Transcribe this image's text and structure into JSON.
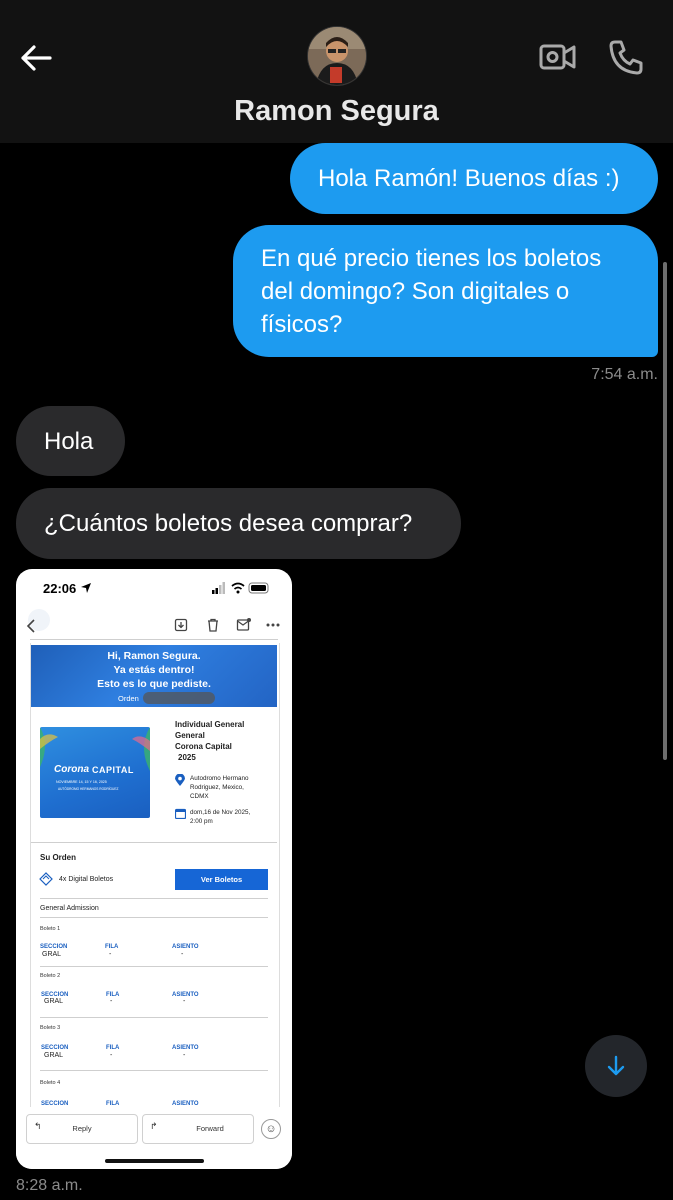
{
  "header": {
    "contact_name": "Ramon Segura",
    "back_icon": "arrow-left-icon",
    "video_icon": "video-call-icon",
    "phone_icon": "phone-icon"
  },
  "messages": {
    "out1": "Hola Ramón! Buenos días :)",
    "out2": "En qué precio tienes los boletos del domingo? Son digitales o físicos?",
    "out_time": "7:54 a.m.",
    "in1": "Hola",
    "in2": "¿Cuántos boletos desea comprar?",
    "image_time": "8:28 a.m."
  },
  "screenshot": {
    "status_time": "22:06",
    "hero_line1": "Hi, Ramon Segura.",
    "hero_line2": "Ya estás dentro!",
    "hero_line3": "Esto es lo que pediste.",
    "order_label": "Orden",
    "poster_brand": "Corona",
    "poster_title": "CAPITAL",
    "poster_dates": "NOVIEMBRE 14, 15 Y 16, 2025",
    "poster_venue": "AUTÓDROMO HERMANOS RODRÍGUEZ",
    "ticket_type_1": "Individual General",
    "ticket_type_2": "General",
    "event_name": "Corona Capital",
    "event_year": "2025",
    "venue_1": "Autodromo Hermano",
    "venue_2": "Rodriguez, Mexico,",
    "venue_3": "CDMX",
    "date_1": "dom,16 de Nov 2025,",
    "date_2": "2:00 pm",
    "order_title": "Su Orden",
    "qty_text": "4x Digital Boletos",
    "ver_boletos": "Ver Boletos",
    "admission": "General Admission",
    "col_section": "SECCION",
    "col_row": "FILA",
    "col_seat": "ASIENTO",
    "tickets": [
      {
        "label": "Boleto 1",
        "section": "GRAL",
        "row": "-",
        "seat": "-"
      },
      {
        "label": "Boleto 2",
        "section": "GRAL",
        "row": "-",
        "seat": "-"
      },
      {
        "label": "Boleto 3",
        "section": "GRAL",
        "row": "-",
        "seat": "-"
      },
      {
        "label": "Boleto 4",
        "section": "",
        "row": "",
        "seat": ""
      }
    ],
    "reply": "Reply",
    "forward": "Forward"
  }
}
